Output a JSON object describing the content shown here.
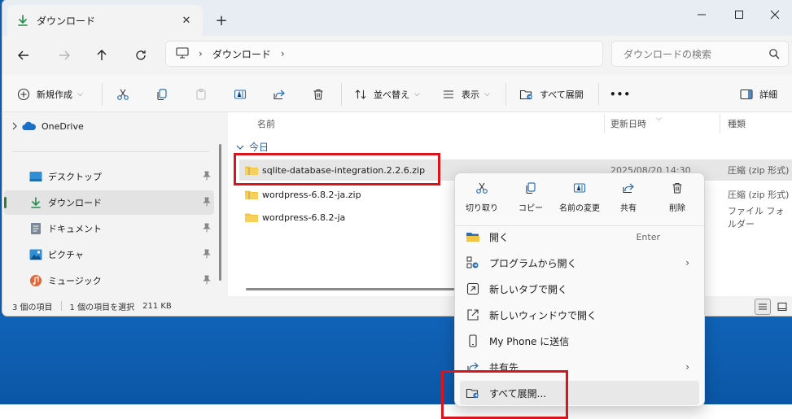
{
  "tab": {
    "title": "ダウンロード",
    "close_glyph": "✕"
  },
  "newtab_glyph": "+",
  "window_controls": {
    "min": "—",
    "max": "☐",
    "close": "✕"
  },
  "address": {
    "sep1": "›",
    "crumb": "ダウンロード",
    "sep2": "›"
  },
  "search": {
    "placeholder": "ダウンロードの検索"
  },
  "commands": {
    "new": "新規作成",
    "sort": "並べ替え",
    "view": "表示",
    "extract_all": "すべて展開",
    "more": "•••",
    "details": "詳細"
  },
  "sidebar": {
    "items": [
      {
        "label": "OneDrive",
        "icon": "cloud-icon"
      },
      {
        "label": "デスクトップ",
        "icon": "desktop-icon"
      },
      {
        "label": "ダウンロード",
        "icon": "download-icon"
      },
      {
        "label": "ドキュメント",
        "icon": "document-icon"
      },
      {
        "label": "ピクチャ",
        "icon": "picture-icon"
      },
      {
        "label": "ミュージック",
        "icon": "music-icon"
      }
    ]
  },
  "columns": {
    "name": "名前",
    "date": "更新日時",
    "type": "種類"
  },
  "group": {
    "label": "今日"
  },
  "files": [
    {
      "name": "sqlite-database-integration.2.2.6.zip",
      "date": "2025/08/20 14:30",
      "type": "圧縮 (zip 形式)",
      "icon": "zip-folder-icon"
    },
    {
      "name": "wordpress-6.8.2-ja.zip",
      "date": "",
      "type": "圧縮 (zip 形式)",
      "icon": "zip-folder-icon"
    },
    {
      "name": "wordpress-6.8.2-ja",
      "date": "",
      "type": "ファイル フォルダー",
      "icon": "folder-icon"
    }
  ],
  "status": {
    "count": "3 個の項目",
    "selected": "1 個の項目を選択",
    "size": "211 KB"
  },
  "context_menu": {
    "top": [
      {
        "label": "切り取り",
        "icon": "scissors-icon"
      },
      {
        "label": "コピー",
        "icon": "copy-icon"
      },
      {
        "label": "名前の変更",
        "icon": "rename-icon"
      },
      {
        "label": "共有",
        "icon": "share-icon"
      },
      {
        "label": "削除",
        "icon": "trash-icon"
      }
    ],
    "items": [
      {
        "label": "開く",
        "shortcut": "Enter",
        "icon": "folder-open-icon"
      },
      {
        "label": "プログラムから開く",
        "icon": "open-with-icon",
        "submenu": "›"
      },
      {
        "label": "新しいタブで開く",
        "icon": "new-tab-icon"
      },
      {
        "label": "新しいウィンドウで開く",
        "icon": "new-window-icon"
      },
      {
        "label": "My Phone に送信",
        "icon": "phone-icon"
      },
      {
        "label": "共有先",
        "icon": "share-to-icon",
        "submenu": "›"
      },
      {
        "label": "すべて展開...",
        "icon": "extract-icon"
      }
    ]
  },
  "colors": {
    "highlight": "#d9141b",
    "accent": "#0b5cad",
    "pin": "#888888"
  }
}
